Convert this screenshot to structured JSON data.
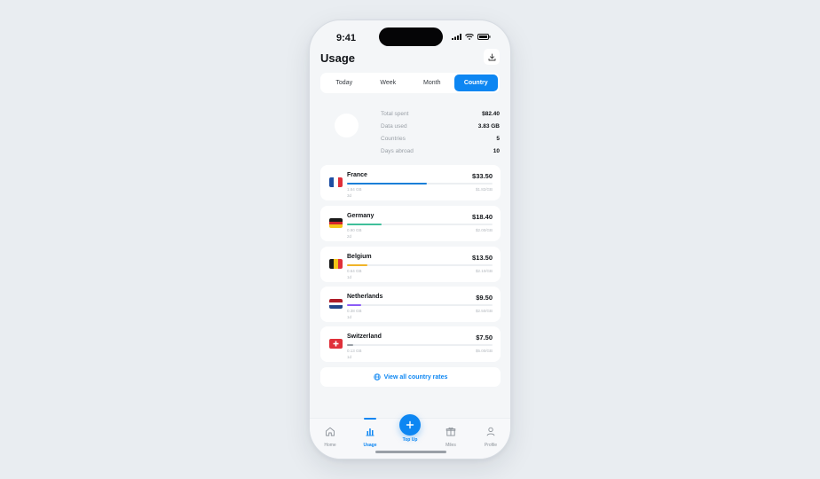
{
  "status_bar": {
    "time": "9:41"
  },
  "header": {
    "title": "Usage"
  },
  "tabs": [
    {
      "label": "Today",
      "active": false
    },
    {
      "label": "Week",
      "active": false
    },
    {
      "label": "Month",
      "active": false
    },
    {
      "label": "Country",
      "active": true
    }
  ],
  "summary": [
    {
      "label": "Total spent",
      "value": "$82.40"
    },
    {
      "label": "Data used",
      "value": "3.83 GB"
    },
    {
      "label": "Countries",
      "value": "5"
    },
    {
      "label": "Days abroad",
      "value": "10"
    }
  ],
  "countries": [
    {
      "name": "France",
      "price": "$33.50",
      "data": "1.84 GB",
      "rate": "$1.82/GB",
      "days": "3d",
      "share": 0.55,
      "color": "#1a7fd8",
      "flag": [
        "#1f4fa3",
        "#ffffff",
        "#e0303a"
      ],
      "flag_dir": "v"
    },
    {
      "name": "Germany",
      "price": "$18.40",
      "data": "0.90 GB",
      "rate": "$2.00/GB",
      "days": "2d",
      "share": 0.24,
      "color": "#3fbf9a",
      "flag": [
        "#1a1a1a",
        "#d3262b",
        "#f5c518"
      ],
      "flag_dir": "h"
    },
    {
      "name": "Belgium",
      "price": "$13.50",
      "data": "0.64 GB",
      "rate": "$2.10/GB",
      "days": "1d",
      "share": 0.14,
      "color": "#f0b429",
      "flag": [
        "#1a1a1a",
        "#f5c518",
        "#e0303a"
      ],
      "flag_dir": "v"
    },
    {
      "name": "Netherlands",
      "price": "$9.50",
      "data": "0.38 GB",
      "rate": "$2.50/GB",
      "days": "1d",
      "share": 0.1,
      "color": "#8b5cf6",
      "flag": [
        "#ae1c28",
        "#ffffff",
        "#21468b"
      ],
      "flag_dir": "h"
    },
    {
      "name": "Switzerland",
      "price": "$7.50",
      "data": "0.13 GB",
      "rate": "$5.00/GB",
      "days": "1d",
      "share": 0.04,
      "color": "#9aa0a7",
      "flag": [
        "#e0303a"
      ],
      "flag_dir": "swiss"
    }
  ],
  "view_all": {
    "label": "View all country rates"
  },
  "nav": [
    {
      "label": "Home",
      "icon": "home-icon"
    },
    {
      "label": "Usage",
      "icon": "bar-chart-icon",
      "active": true
    },
    {
      "label": "Top Up",
      "icon": "plus-icon"
    },
    {
      "label": "Miles",
      "icon": "gift-icon"
    },
    {
      "label": "Profile",
      "icon": "person-icon"
    }
  ]
}
